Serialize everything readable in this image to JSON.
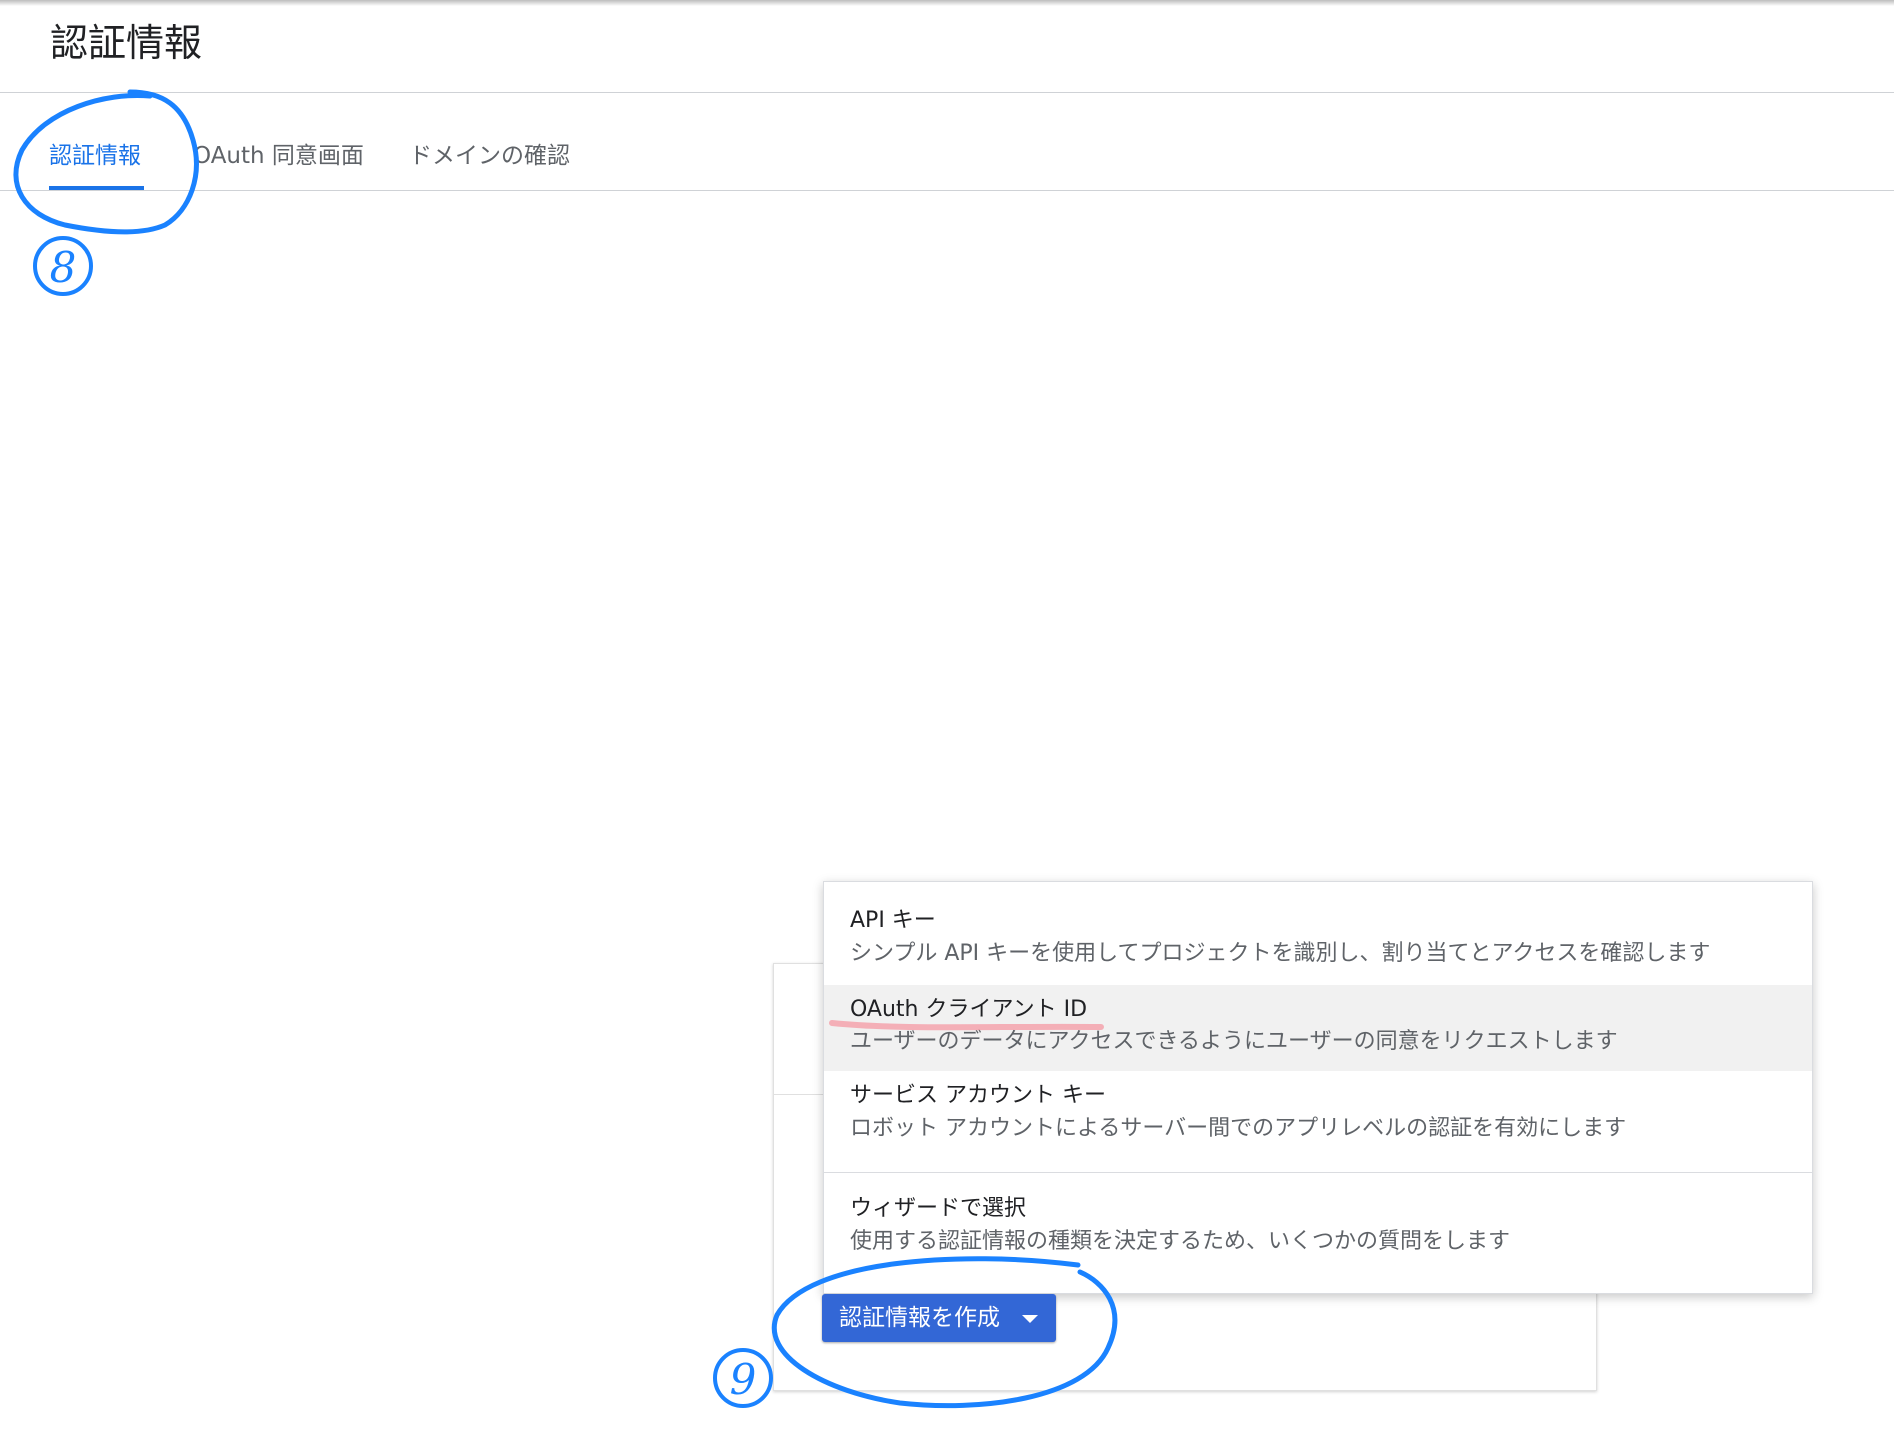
{
  "page": {
    "title": "認証情報"
  },
  "tabs": [
    {
      "label": "認証情報",
      "active": true
    },
    {
      "label": "OAuth 同意画面",
      "active": false
    },
    {
      "label": "ドメインの確認",
      "active": false
    }
  ],
  "create_button": {
    "label": "認証情報を作成",
    "icon": "caret-down-icon"
  },
  "menu": {
    "items": [
      {
        "title": "API キー",
        "description": "シンプル API キーを使用してプロジェクトを識別し、割り当てとアクセスを確認します"
      },
      {
        "title": "OAuth クライアント ID",
        "description": "ユーザーのデータにアクセスできるようにユーザーの同意をリクエストします",
        "highlighted": true
      },
      {
        "title": "サービス アカウント キー",
        "description": "ロボット アカウントによるサーバー間でのアプリレベルの認証を有効にします"
      },
      {
        "title": "ウィザードで選択",
        "description": "使用する認証情報の種類を決定するため、いくつかの質問をします"
      }
    ]
  },
  "annotations": {
    "step_8": "8",
    "step_9": "9",
    "circle_color": "#1a82ff",
    "underline_color": "#f4a3ad"
  },
  "colors": {
    "accent": "#1a73e8",
    "button": "#3367d6"
  }
}
